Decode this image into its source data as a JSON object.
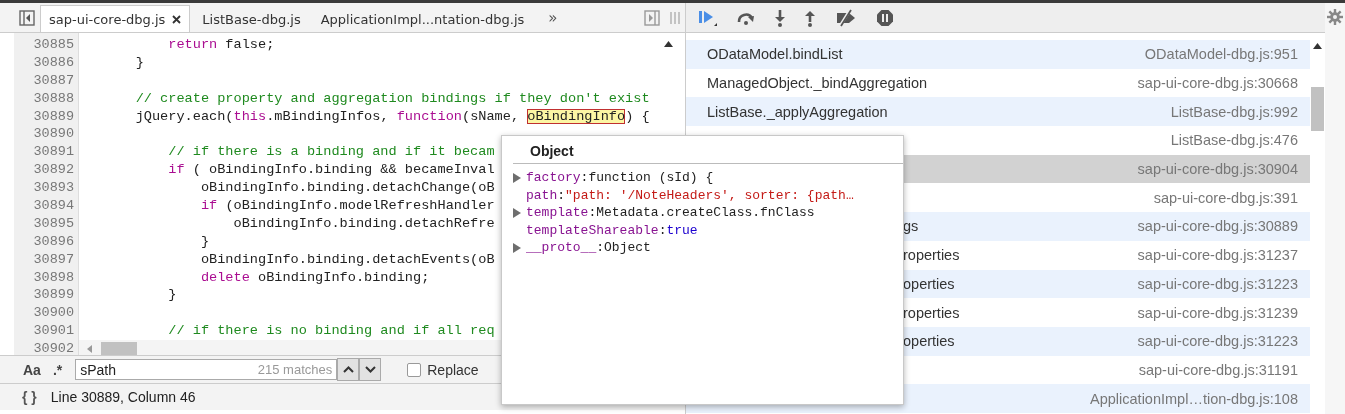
{
  "editor": {
    "tabs": [
      {
        "label": "sap-ui-core-dbg.js",
        "selected": true,
        "closable": true
      },
      {
        "label": "ListBase-dbg.js",
        "selected": false,
        "closable": false
      },
      {
        "label": "ApplicationImpl...ntation-dbg.js",
        "selected": false,
        "closable": false
      }
    ],
    "more_tabs": "»",
    "lines": [
      {
        "children": [
          {
            "number": "30885",
            "tokens": [
              {
                "kind": "keyword",
                "text": "return"
              },
              {
                "kind": "plain",
                "text": " false;"
              }
            ]
          }
        ]
      },
      {
        "number": "30886",
        "tokens": [
          {
            "kind": "plain",
            "text": "}"
          }
        ]
      },
      {
        "number": "30887"
      },
      {
        "number": "30888",
        "tokens": [
          {
            "kind": "comment",
            "text": "// create property and aggregation bindings if they don't exist"
          }
        ]
      },
      {
        "number": "30889",
        "tokens": [
          {
            "kind": "plain",
            "text": "jQuery.each("
          },
          {
            "kind": "keyword",
            "text": "this"
          },
          {
            "kind": "plain",
            "text": ".mBindingInfos, "
          },
          {
            "kind": "keyword",
            "text": "function"
          },
          {
            "kind": "plain",
            "text": "(sName, "
          },
          {
            "kind": "highlight",
            "text": "oBindingInfo"
          },
          {
            "kind": "plain",
            "text": ") {"
          }
        ],
        "children": [
          {
            "number": "30890"
          },
          {
            "number": "30891",
            "tokens": [
              {
                "kind": "comment",
                "text": "// if there is a binding and if it becam"
              }
            ]
          },
          {
            "number": "30892",
            "tokens": [
              {
                "kind": "keyword",
                "text": "if"
              },
              {
                "kind": "plain",
                "text": " ( oBindingInfo.binding && becameInval"
              }
            ],
            "children": [
              {
                "number": "30893",
                "tokens": [
                  {
                    "kind": "plain",
                    "text": "oBindingInfo.binding.detachChange(oB"
                  }
                ]
              },
              {
                "number": "30894",
                "tokens": [
                  {
                    "kind": "keyword",
                    "text": "if"
                  },
                  {
                    "kind": "plain",
                    "text": " (oBindingInfo.modelRefreshHandler"
                  }
                ],
                "children": [
                  {
                    "number": "30895",
                    "tokens": [
                      {
                        "kind": "plain",
                        "text": "oBindingInfo.binding.detachRefre"
                      }
                    ]
                  }
                ]
              },
              {
                "number": "30896",
                "tokens": [
                  {
                    "kind": "plain",
                    "text": "}"
                  }
                ]
              },
              {
                "number": "30897",
                "tokens": [
                  {
                    "kind": "plain",
                    "text": "oBindingInfo.binding.detachEvents(oB"
                  }
                ]
              },
              {
                "number": "30898",
                "tokens": [
                  {
                    "kind": "keyword",
                    "text": "delete"
                  },
                  {
                    "kind": "plain",
                    "text": " oBindingInfo.binding;"
                  }
                ]
              }
            ]
          },
          {
            "number": "30899",
            "tokens": [
              {
                "kind": "plain",
                "text": "}"
              }
            ]
          },
          {
            "number": "30900"
          },
          {
            "number": "30901",
            "tokens": [
              {
                "kind": "comment",
                "text": "// if there is no binding and if all req"
              }
            ]
          }
        ]
      }
    ],
    "last_line_number": "30902",
    "search": {
      "case_toggle": "Aa",
      "regex_toggle": ".*",
      "value": "sPath",
      "matches": "215 matches",
      "replace": {
        "label": "Replace",
        "checked": false
      }
    },
    "status": {
      "format_button": "{ }",
      "position": "Line 30889, Column 46"
    }
  },
  "call_stack": {
    "frames": [
      {
        "name": "ODataModel.bindList",
        "location": "ODataModel-dbg.js:951",
        "selected": false
      },
      {
        "name": "ManagedObject._bindAggregation",
        "location": "sap-ui-core-dbg.js:30668",
        "selected": false
      },
      {
        "name": "ListBase._applyAggregation",
        "location": "ListBase-dbg.js:992",
        "selected": false
      },
      {
        "location": "ListBase-dbg.js:476",
        "selected": false
      },
      {
        "location": "sap-ui-core-dbg.js:30904",
        "selected": true
      },
      {
        "location": "sap-ui-core-dbg.js:391",
        "selected": false
      },
      {
        "name": "gs",
        "location": "sap-ui-core-dbg.js:30889",
        "selected": false,
        "covered": true
      },
      {
        "name": "roperties",
        "location": "sap-ui-core-dbg.js:31237",
        "selected": false,
        "covered": true
      },
      {
        "name": "operties",
        "location": "sap-ui-core-dbg.js:31223",
        "selected": false,
        "covered": true
      },
      {
        "name": "roperties",
        "location": "sap-ui-core-dbg.js:31239",
        "selected": false,
        "covered": true
      },
      {
        "name": "operties",
        "location": "sap-ui-core-dbg.js:31223",
        "selected": false,
        "covered": true
      },
      {
        "location": "sap-ui-core-dbg.js:31191",
        "selected": false
      },
      {
        "location": "ApplicationImpl…tion-dbg.js:108",
        "selected": false
      }
    ]
  },
  "popover": {
    "title": "Object",
    "properties": [
      {
        "name": "factory",
        "separator": ":",
        "value": "function (sId) {",
        "kind": "plain",
        "expandable": true
      },
      {
        "name": "path",
        "separator": ":",
        "value": "\"path: '/NoteHeaders', sorter: {path…",
        "kind": "string",
        "expandable": false
      },
      {
        "name": "template",
        "separator": ":",
        "value": "Metadata.createClass.fnClass",
        "kind": "plain",
        "expandable": true
      },
      {
        "name": "templateShareable",
        "separator": ":",
        "value": "true",
        "kind": "boolean",
        "expandable": false
      },
      {
        "name": "__proto__",
        "separator": ":",
        "value": "Object",
        "kind": "plain",
        "expandable": true
      }
    ]
  }
}
